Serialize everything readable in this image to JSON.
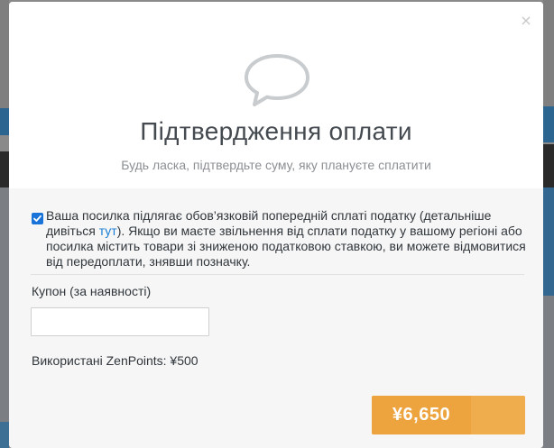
{
  "modal": {
    "close_glyph": "×",
    "title": "Підтвердження оплати",
    "subtitle": "Будь ласка, підтвердьте суму, яку плануєте сплатити",
    "icon": "speech-bubble-icon"
  },
  "tax": {
    "checked": true,
    "text_before": "Ваша посилка підлягає обов’язковій попередній сплаті податку (детальніше дивіться ",
    "link_text": "тут",
    "text_after": "). Якщо ви маєте звільнення від сплати податку у вашому регіоні або посилка містить товари зі зниженою податковою ставкою, ви можете відмовитися від передоплати, знявши позначку."
  },
  "coupon": {
    "label": "Купон (за наявності)",
    "value": "",
    "placeholder": ""
  },
  "points": {
    "text": "Використані ZenPoints: ¥500"
  },
  "pay_button": {
    "amount": "¥6,650"
  },
  "colors": {
    "accent": "#f0ad4e",
    "checkbox": "#1a73d9",
    "link": "#1b7fd4"
  }
}
